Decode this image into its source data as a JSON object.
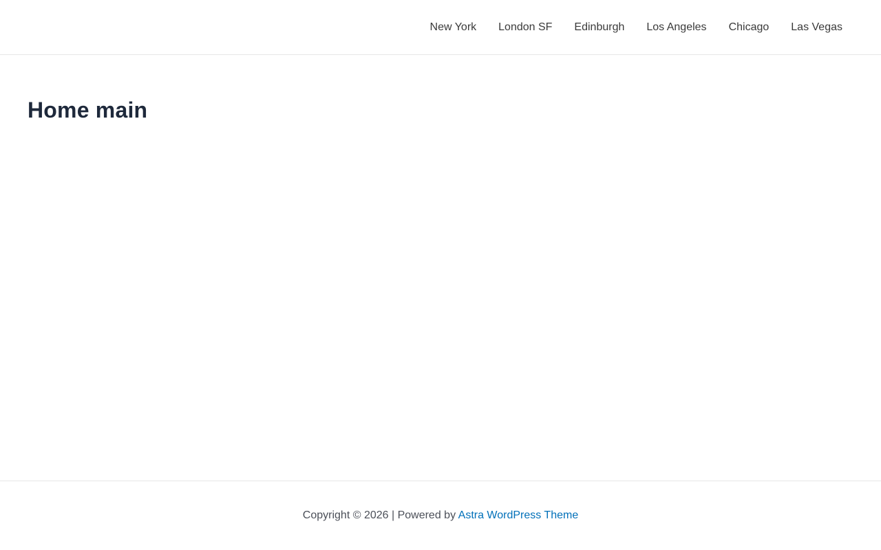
{
  "nav": {
    "items": [
      {
        "label": "New York"
      },
      {
        "label": "London SF"
      },
      {
        "label": "Edinburgh"
      },
      {
        "label": "Los Angeles"
      },
      {
        "label": "Chicago"
      },
      {
        "label": "Las Vegas"
      }
    ]
  },
  "main": {
    "title": "Home main"
  },
  "footer": {
    "copyright": "Copyright © 2026 | Powered by ",
    "link_label": "Astra WordPress Theme"
  },
  "colors": {
    "title": "#1e293b",
    "link": "#0170b9",
    "nav_text": "#3a3a3a",
    "border": "#e6e6e6"
  }
}
